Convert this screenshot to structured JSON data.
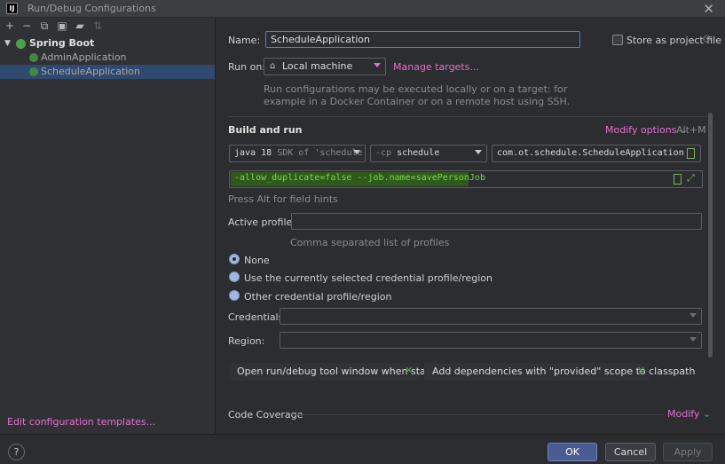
{
  "window": {
    "title": "Run/Debug Configurations",
    "logo_text": "IJ"
  },
  "tree": {
    "root_label": "Spring Boot",
    "items": [
      {
        "label": "AdminApplication"
      },
      {
        "label": "ScheduleApplication"
      }
    ],
    "edit_templates_label": "Edit configuration templates..."
  },
  "form": {
    "name_label": "Name:",
    "name_value": "ScheduleApplication",
    "store_label": "Store as project file",
    "store_checked": false,
    "run_on_label": "Run on:",
    "run_on_value": "Local machine",
    "manage_targets": "Manage targets...",
    "run_on_hint_1": "Run configurations may be executed locally or on a target: for",
    "run_on_hint_2": "example in a Docker Container or on a remote host using SSH.",
    "build_run_title": "Build and run",
    "modify_options": "Modify options",
    "modify_shortcut": "Alt+M",
    "java_version": "java 18",
    "java_sdk_hint": "SDK of 'schedule",
    "cp_prefix": "-cp",
    "cp_value": "schedule",
    "main_class": "com.ot.schedule.ScheduleApplication",
    "program_args": "-allow_duplicate=false --job.name=savePersonJob",
    "field_hints": "Press Alt for field hints",
    "active_profiles_label": "Active profiles:",
    "active_profiles_value": "",
    "active_profiles_hint": "Comma separated list of profiles",
    "credential_options": [
      {
        "label": "None",
        "selected": true
      },
      {
        "label": "Use the currently selected credential profile/region",
        "selected": false
      },
      {
        "label": "Other credential profile/region",
        "selected": false
      }
    ],
    "credentials_label": "Credentials:",
    "region_label": "Region:",
    "chips": [
      {
        "label": "Open run/debug tool window when started"
      },
      {
        "label": "Add dependencies with \"provided\" scope to classpath"
      }
    ],
    "code_coverage_label": "Code Coverage",
    "code_coverage_modify": "Modify"
  },
  "buttons": {
    "ok": "OK",
    "cancel": "Cancel",
    "apply": "Apply",
    "help": "?"
  },
  "colors": {
    "accent_link": "#e56fd0",
    "selection": "#2f4a6e",
    "args_highlight": "#2f5a1c",
    "args_text": "#7fd64b"
  }
}
